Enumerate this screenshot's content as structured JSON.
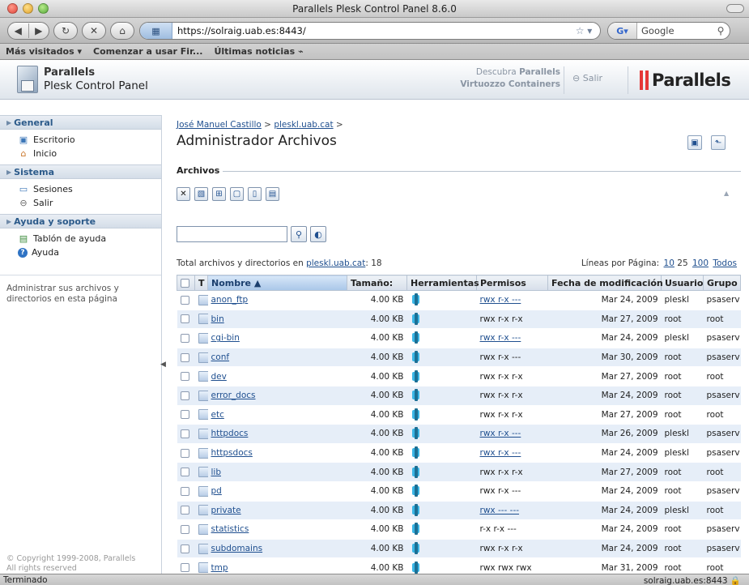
{
  "window": {
    "title": "Parallels Plesk Control Panel 8.6.0"
  },
  "browser": {
    "url": "https://solraig.uab.es:8443/",
    "search_engine": "G",
    "search_placeholder": "Google",
    "bookmarks": [
      "Más visitados ▾",
      "Comenzar a usar Fir...",
      "Últimas noticias ⌁"
    ],
    "status_left": "Terminado",
    "status_right": "solraig.uab.es:8443"
  },
  "header": {
    "brand_line1": "Parallels",
    "brand_line2": "Plesk Control Panel",
    "promo_line1": "Descubra ",
    "promo_line1_bold": "Parallels",
    "promo_line2": "Virtuozzo Containers",
    "salir": "Salir",
    "logo_text": "Parallels"
  },
  "sidebar": {
    "sections": [
      {
        "title": "General",
        "items": [
          {
            "label": "Escritorio",
            "icon": "desktop-icon"
          },
          {
            "label": "Inicio",
            "icon": "home-icon"
          }
        ]
      },
      {
        "title": "Sistema",
        "items": [
          {
            "label": "Sesiones",
            "icon": "sessions-icon"
          },
          {
            "label": "Salir",
            "icon": "logout-icon"
          }
        ]
      },
      {
        "title": "Ayuda y soporte",
        "items": [
          {
            "label": "Tablón de ayuda",
            "icon": "helpdesk-icon"
          },
          {
            "label": "Ayuda",
            "icon": "help-icon"
          }
        ]
      }
    ],
    "help_text": "Administrar sus archivos y directorios en esta página",
    "copyright1": "© Copyright 1999-2008, Parallels",
    "copyright2": "All rights reserved"
  },
  "main": {
    "breadcrumb_user": "José Manuel Castillo",
    "breadcrumb_sep1": " > ",
    "breadcrumb_domain": "pleskl.uab.cat",
    "breadcrumb_sep2": " >",
    "title": "Administrador Archivos",
    "section": "Archivos",
    "totals_prefix": "Total archivos y directorios en ",
    "totals_domain": "pleskl.uab.cat",
    "totals_count": ": 18",
    "perpage_label": "Líneas por Página: ",
    "perpage_options": [
      "10",
      "25",
      "100",
      "Todos"
    ],
    "columns": [
      "T",
      "Nombre ▲",
      "Tamaño:",
      "Herramientas",
      "Permisos",
      "Fecha de modificación",
      "Usuario",
      "Grupo"
    ],
    "rows": [
      {
        "name": "anon_ftp",
        "size": "4.00 KB",
        "perm": "rwx r-x ---",
        "perm_link": true,
        "date": "Mar 24, 2009",
        "user": "pleskl",
        "group": "psaserv"
      },
      {
        "name": "bin",
        "size": "4.00 KB",
        "perm": "rwx r-x r-x",
        "perm_link": false,
        "date": "Mar 27, 2009",
        "user": "root",
        "group": "root"
      },
      {
        "name": "cgi-bin",
        "size": "4.00 KB",
        "perm": "rwx r-x ---",
        "perm_link": true,
        "date": "Mar 24, 2009",
        "user": "pleskl",
        "group": "psaserv"
      },
      {
        "name": "conf",
        "size": "4.00 KB",
        "perm": "rwx r-x ---",
        "perm_link": false,
        "date": "Mar 30, 2009",
        "user": "root",
        "group": "psaserv"
      },
      {
        "name": "dev",
        "size": "4.00 KB",
        "perm": "rwx r-x r-x",
        "perm_link": false,
        "date": "Mar 27, 2009",
        "user": "root",
        "group": "root"
      },
      {
        "name": "error_docs",
        "size": "4.00 KB",
        "perm": "rwx r-x r-x",
        "perm_link": false,
        "date": "Mar 24, 2009",
        "user": "root",
        "group": "psaserv"
      },
      {
        "name": "etc",
        "size": "4.00 KB",
        "perm": "rwx r-x r-x",
        "perm_link": false,
        "date": "Mar 27, 2009",
        "user": "root",
        "group": "root"
      },
      {
        "name": "httpdocs",
        "size": "4.00 KB",
        "perm": "rwx r-x ---",
        "perm_link": true,
        "date": "Mar 26, 2009",
        "user": "pleskl",
        "group": "psaserv"
      },
      {
        "name": "httpsdocs",
        "size": "4.00 KB",
        "perm": "rwx r-x ---",
        "perm_link": true,
        "date": "Mar 24, 2009",
        "user": "pleskl",
        "group": "psaserv"
      },
      {
        "name": "lib",
        "size": "4.00 KB",
        "perm": "rwx r-x r-x",
        "perm_link": false,
        "date": "Mar 27, 2009",
        "user": "root",
        "group": "root"
      },
      {
        "name": "pd",
        "size": "4.00 KB",
        "perm": "rwx r-x ---",
        "perm_link": false,
        "date": "Mar 24, 2009",
        "user": "root",
        "group": "psaserv"
      },
      {
        "name": "private",
        "size": "4.00 KB",
        "perm": "rwx --- ---",
        "perm_link": true,
        "date": "Mar 24, 2009",
        "user": "pleskl",
        "group": "root"
      },
      {
        "name": "statistics",
        "size": "4.00 KB",
        "perm": "r-x r-x ---",
        "perm_link": false,
        "date": "Mar 24, 2009",
        "user": "root",
        "group": "psaserv"
      },
      {
        "name": "subdomains",
        "size": "4.00 KB",
        "perm": "rwx r-x r-x",
        "perm_link": false,
        "date": "Mar 24, 2009",
        "user": "root",
        "group": "psaserv"
      },
      {
        "name": "tmp",
        "size": "4.00 KB",
        "perm": "rwx rwx rwx",
        "perm_link": false,
        "date": "Mar 31, 2009",
        "user": "root",
        "group": "root"
      }
    ]
  },
  "colors": {
    "accent": "#1f4f8f",
    "row_alt": "#e6eef8",
    "brand_red": "#e53838"
  }
}
